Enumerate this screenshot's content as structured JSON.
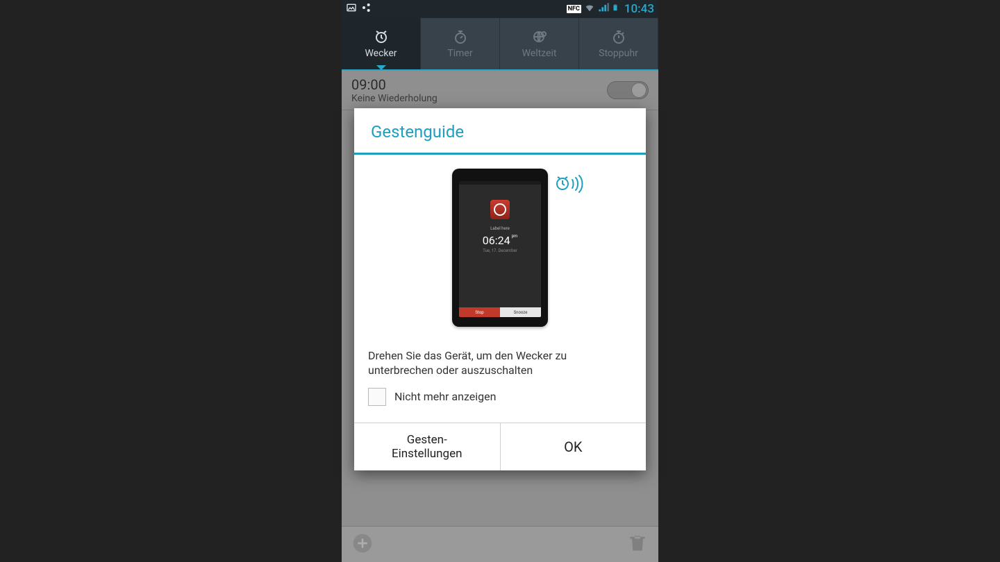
{
  "status": {
    "time": "10:43",
    "nfc": "NFC"
  },
  "tabs": [
    {
      "label": "Wecker",
      "active": true
    },
    {
      "label": "Timer",
      "active": false
    },
    {
      "label": "Weltzeit",
      "active": false
    },
    {
      "label": "Stoppuhr",
      "active": false
    }
  ],
  "alarm": {
    "time": "09:00",
    "repeat": "Keine Wiederholung"
  },
  "dialog": {
    "title": "Gestenguide",
    "illustration": {
      "label": "Label here",
      "time": "06:24",
      "ampm": "pm",
      "date": "Tue, 17. December",
      "stop": "Stop",
      "snooze": "Snooze"
    },
    "text": "Drehen Sie das Gerät, um den Wecker zu unterbrechen oder auszuschalten",
    "checkbox_label": "Nicht mehr anzeigen",
    "btn_settings": "Gesten-\nEinstellungen",
    "btn_ok": "OK"
  }
}
